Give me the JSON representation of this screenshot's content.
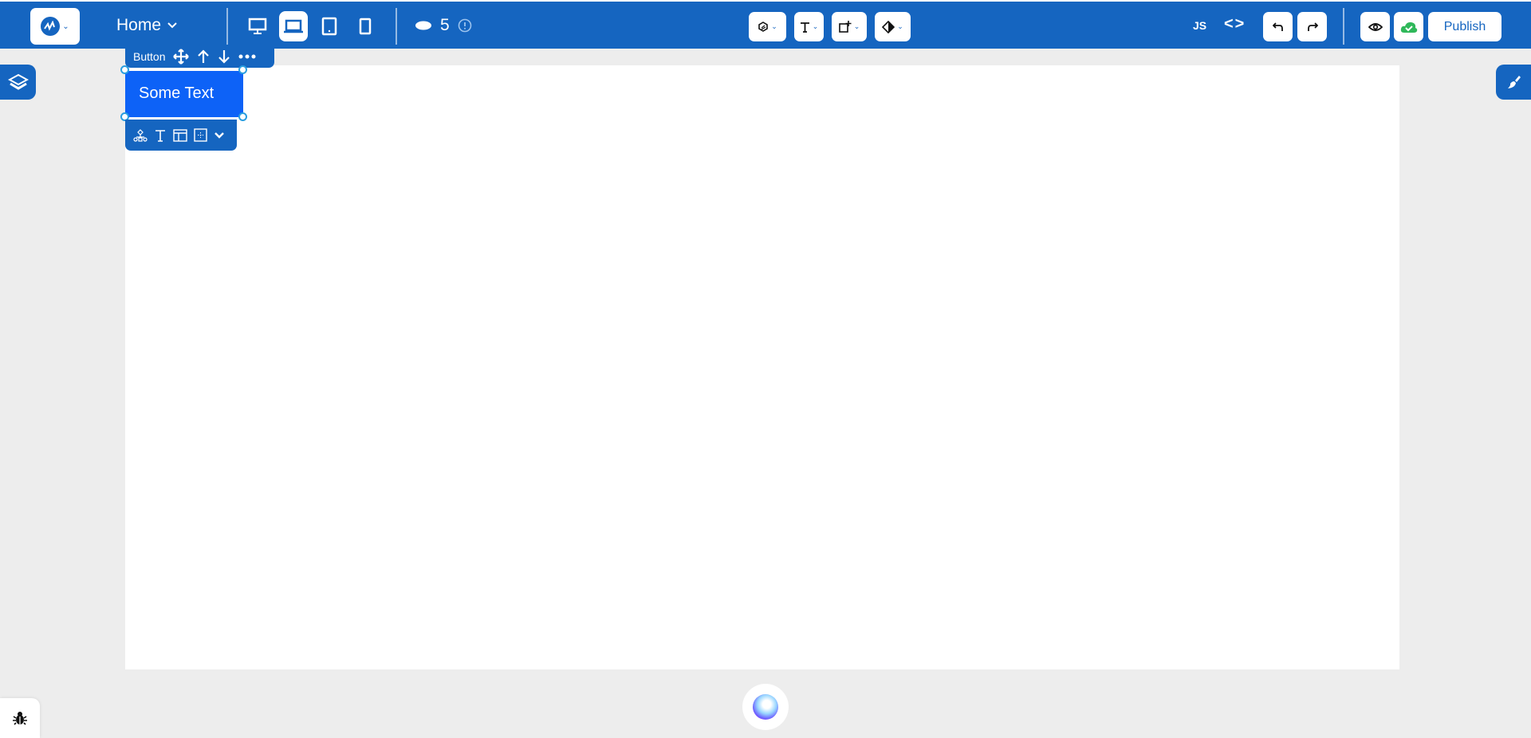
{
  "header": {
    "page_selector": "Home",
    "device_modes": [
      "desktop",
      "laptop",
      "tablet",
      "mobile"
    ],
    "active_device": "laptop",
    "credits_count": "5",
    "tools": [
      "ai-tool",
      "text-tool",
      "add-element-tool",
      "theme-tool"
    ],
    "js_label": "JS",
    "code_label": "<>",
    "publish_label": "Publish"
  },
  "selection": {
    "element_type": "Button",
    "button_text": "Some Text"
  },
  "colors": {
    "primary": "#1565c0",
    "selected_button": "#0d62f7",
    "saved_green": "#2fb85a"
  }
}
